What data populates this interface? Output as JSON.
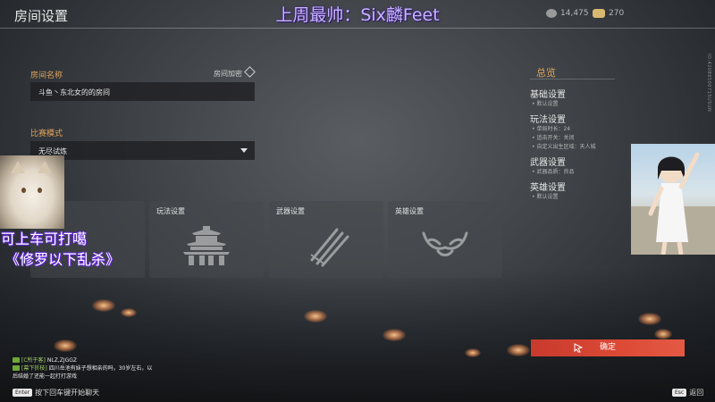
{
  "header": {
    "page_title": "房间设置",
    "stream_title": "上周最帅：Six麟Feet",
    "coins": "14,475",
    "gold": "270"
  },
  "side_id": "ID:4208650071SUSUN",
  "form": {
    "room_name_label": "房间名称",
    "room_lock_label": "房间加密",
    "room_name_value": "斗鱼丶东北女的的房间",
    "mode_label": "比赛模式",
    "mode_value": "无尽试炼"
  },
  "cards": [
    {
      "label": "",
      "icon": "base-settings-icon"
    },
    {
      "label": "玩法设置",
      "icon": "temple-icon"
    },
    {
      "label": "武器设置",
      "icon": "swords-icon"
    },
    {
      "label": "英雄设置",
      "icon": "hero-mask-icon"
    }
  ],
  "summary": {
    "title": "总览",
    "sections": [
      {
        "heading": "基础设置",
        "items": [
          "默认设置"
        ]
      },
      {
        "heading": "玩法设置",
        "items": [
          "单局时长：24",
          "追击开关：关闭",
          "自定义出生区域：天人城"
        ]
      },
      {
        "heading": "武器设置",
        "items": [
          "武器品质：良品"
        ]
      },
      {
        "heading": "英雄设置",
        "items": [
          "默认设置"
        ]
      }
    ]
  },
  "overlay": {
    "caption_line1": "可上车可打噶",
    "caption_line2": "《修罗以下乱杀》"
  },
  "confirm_label": "确定",
  "chat": {
    "messages": [
      {
        "name": "[C所于客]",
        "text": "NLZ,ZJGGZ"
      },
      {
        "name": "[幕下折枝]",
        "text": "四川岳池有妹子想相亲的吗，30岁左右，以"
      }
    ],
    "continuation": "后结婚了还能一起打打游戏",
    "enter_key": "Enter",
    "enter_hint": "按下回车键开始聊天"
  },
  "esc": {
    "key": "Esc",
    "label": "返回"
  },
  "colors": {
    "accent_orange": "#e0a45b",
    "confirm_red": "#dd4a36",
    "caption_purple": "#7a3ef0"
  }
}
